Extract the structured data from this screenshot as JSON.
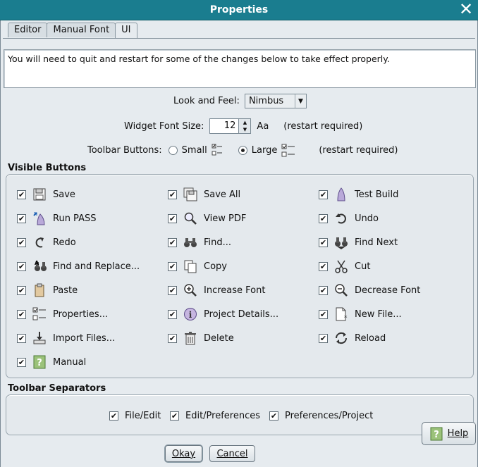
{
  "window": {
    "title": "Properties"
  },
  "tabs": [
    {
      "label": "Editor"
    },
    {
      "label": "Manual Font"
    },
    {
      "label": "UI"
    }
  ],
  "notice": "You will need to quit and restart for some of the changes below to take effect properly.",
  "look_and_feel": {
    "label": "Look and Feel:",
    "value": "Nimbus"
  },
  "widget_font": {
    "label": "Widget Font Size:",
    "value": "12",
    "suffix": "Aa",
    "note": "(restart required)"
  },
  "toolbar_buttons": {
    "label": "Toolbar Buttons:",
    "small": "Small",
    "large": "Large",
    "selected": "Large",
    "note": "(restart required)"
  },
  "visible_buttons": {
    "title": "Visible Buttons",
    "items": [
      {
        "label": "Save",
        "icon": "save-icon",
        "checked": true
      },
      {
        "label": "Save All",
        "icon": "save-all-icon",
        "checked": true
      },
      {
        "label": "Test Build",
        "icon": "test-build-icon",
        "checked": true
      },
      {
        "label": "Run PASS",
        "icon": "run-pass-icon",
        "checked": true
      },
      {
        "label": "View PDF",
        "icon": "view-pdf-icon",
        "checked": true
      },
      {
        "label": "Undo",
        "icon": "undo-icon",
        "checked": true
      },
      {
        "label": "Redo",
        "icon": "redo-icon",
        "checked": true
      },
      {
        "label": "Find...",
        "icon": "find-icon",
        "checked": true
      },
      {
        "label": "Find Next",
        "icon": "find-next-icon",
        "checked": true
      },
      {
        "label": "Find and Replace...",
        "icon": "find-replace-icon",
        "checked": true
      },
      {
        "label": "Copy",
        "icon": "copy-icon",
        "checked": true
      },
      {
        "label": "Cut",
        "icon": "cut-icon",
        "checked": true
      },
      {
        "label": "Paste",
        "icon": "paste-icon",
        "checked": true
      },
      {
        "label": "Increase Font",
        "icon": "zoom-in-icon",
        "checked": true
      },
      {
        "label": "Decrease Font",
        "icon": "zoom-out-icon",
        "checked": true
      },
      {
        "label": "Properties...",
        "icon": "properties-icon",
        "checked": true
      },
      {
        "label": "Project Details...",
        "icon": "info-icon",
        "checked": true
      },
      {
        "label": "New File...",
        "icon": "new-file-icon",
        "checked": true
      },
      {
        "label": "Import Files...",
        "icon": "import-icon",
        "checked": true
      },
      {
        "label": "Delete",
        "icon": "trash-icon",
        "checked": true
      },
      {
        "label": "Reload",
        "icon": "reload-icon",
        "checked": true
      },
      {
        "label": "Manual",
        "icon": "help-icon",
        "checked": true
      }
    ]
  },
  "toolbar_separators": {
    "title": "Toolbar Separators",
    "items": [
      {
        "label": "File/Edit",
        "checked": true
      },
      {
        "label": "Edit/Preferences",
        "checked": true
      },
      {
        "label": "Preferences/Project",
        "checked": true
      }
    ]
  },
  "buttons": {
    "okay": "Okay",
    "cancel": "Cancel",
    "help": "Help"
  },
  "colors": {
    "titlebar": "#1a7d8f",
    "background": "#e6ebef"
  }
}
